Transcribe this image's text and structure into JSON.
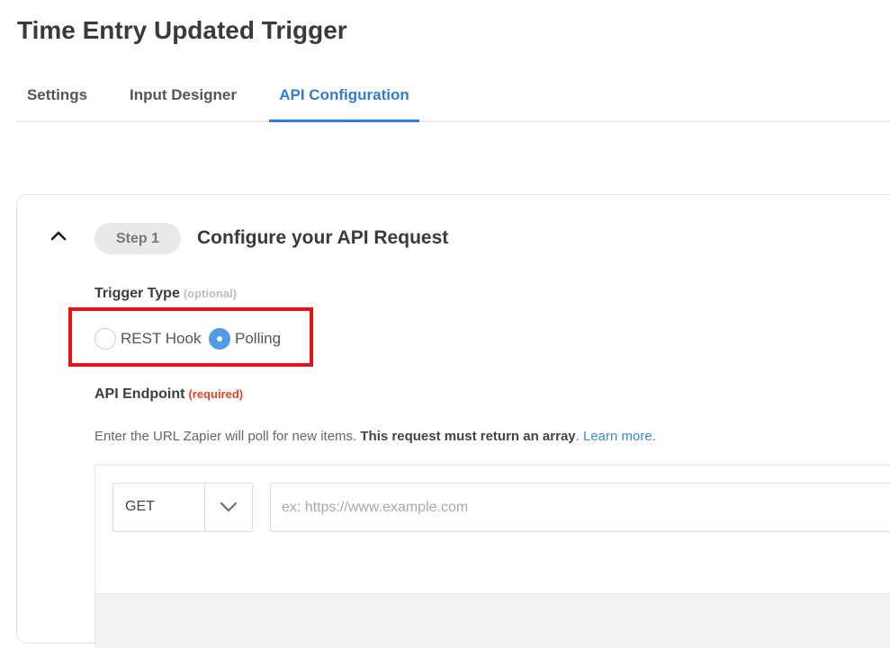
{
  "page": {
    "title": "Time Entry Updated Trigger"
  },
  "tabs": [
    {
      "label": "Settings",
      "active": false
    },
    {
      "label": "Input Designer",
      "active": false
    },
    {
      "label": "API Configuration",
      "active": true
    }
  ],
  "step": {
    "badge": "Step 1",
    "title": "Configure your API Request",
    "collapse_icon": "chevron-up-icon"
  },
  "trigger_type": {
    "label": "Trigger Type",
    "qualifier": "(optional)",
    "options": [
      {
        "label": "REST Hook",
        "selected": false
      },
      {
        "label": "Polling",
        "selected": true
      }
    ]
  },
  "api_endpoint": {
    "label": "API Endpoint",
    "qualifier": "(required)",
    "help_prefix": "Enter the URL Zapier will poll for new items. ",
    "help_bold": "This request must return an array",
    "help_suffix": ". ",
    "help_link": "Learn more",
    "help_end": ".",
    "method": "GET",
    "url_value": "",
    "url_placeholder": "ex: https://www.example.com"
  },
  "colors": {
    "accent": "#2f7bd8",
    "highlight": "#e8121a",
    "required": "#e3432d",
    "radio_selected": "#4f9be8"
  }
}
